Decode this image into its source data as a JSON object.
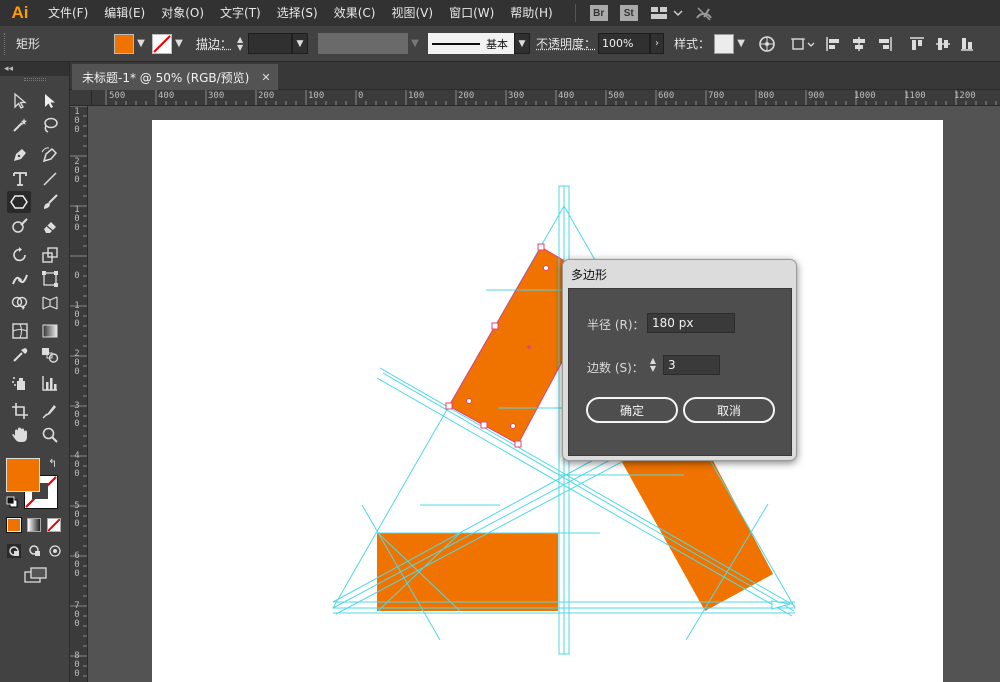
{
  "app": {
    "logo": "Ai"
  },
  "menu": [
    "文件(F)",
    "编辑(E)",
    "对象(O)",
    "文字(T)",
    "选择(S)",
    "效果(C)",
    "视图(V)",
    "窗口(W)",
    "帮助(H)"
  ],
  "menubar_badges": {
    "br": "Br",
    "st": "St"
  },
  "control": {
    "tool_name": "矩形",
    "fill_color": "#f07300",
    "stroke_label": "描边：",
    "line_style": "基本",
    "opacity_label": "不透明度：",
    "opacity_value": "100%",
    "style_label": "样式："
  },
  "document": {
    "tab_title": "未标题-1* @ 50% (RGB/预览)"
  },
  "ruler": {
    "h_labels": [
      "500",
      "400",
      "300",
      "200",
      "100",
      "0",
      "100",
      "200",
      "300",
      "400",
      "500",
      "600",
      "700",
      "800",
      "900",
      "1000",
      "1100",
      "1200"
    ],
    "v_labels": [
      "100",
      "200",
      "100",
      "0",
      "100",
      "200",
      "300",
      "400",
      "500",
      "600",
      "700",
      "800"
    ]
  },
  "tools": {
    "fill_color": "#f07300",
    "accent_stroke": "#ff0000"
  },
  "artwork": {
    "shape_color": "#f07300",
    "guide_color": "#4fd9e6"
  },
  "dialog": {
    "title": "多边形",
    "radius_label": "半径 (R)：",
    "radius_value": "180 px",
    "sides_label": "边数 (S)：",
    "sides_value": "3",
    "ok_label": "确定",
    "cancel_label": "取消"
  }
}
